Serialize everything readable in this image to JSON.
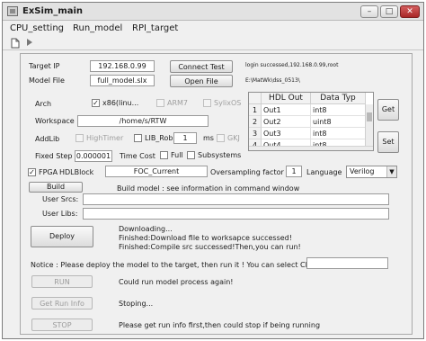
{
  "window": {
    "title": "ExSim_main",
    "controls": {
      "minimize": "–",
      "maximize": "□",
      "close": "✕"
    }
  },
  "menu": {
    "items": [
      "CPU_setting",
      "Run_model",
      "RPI_target"
    ]
  },
  "toolbar": {
    "icons": [
      "new-file-icon",
      "play-icon"
    ]
  },
  "target": {
    "ip_label": "Target IP",
    "ip_value": "192.168.0.99",
    "model_label": "Model File",
    "model_value": "full_model.slx",
    "connect_button": "Connect Test",
    "open_button": "Open File",
    "login_status": "login successed,192.168.0.99,root",
    "model_path": "E:\\MatWk\\dss_0513\\"
  },
  "arch": {
    "label": "Arch",
    "options": [
      {
        "label": "x86(linu...",
        "checked": true,
        "enabled": true
      },
      {
        "label": "ARM7",
        "checked": false,
        "enabled": false
      },
      {
        "label": "SylixOS",
        "checked": false,
        "enabled": false
      }
    ]
  },
  "workspace": {
    "label": "Workspace",
    "value": "/home/s/RTW"
  },
  "addlib": {
    "label": "AddLib",
    "hightimer": "HighTimer",
    "lib_robot": "LIB_Robot",
    "ms_value": "1",
    "ms_label": "ms",
    "gkj": "GKJ"
  },
  "fixed_step": {
    "label": "Fixed Step",
    "value": "0.000001",
    "time_cost": "Time Cost",
    "full": "Full",
    "subsystems": "Subsystems"
  },
  "fpga": {
    "label": "FPGA",
    "checked": true,
    "hdlblock_label": "HDLBlock",
    "hdlblock_value": "FOC_Current",
    "oversampling_label": "Oversampling factor",
    "oversampling_value": "1",
    "language_label": "Language",
    "language_value": "Verilog"
  },
  "hdl_table": {
    "headers": [
      "HDL Out",
      "Data Typ"
    ],
    "rows": [
      {
        "n": "1",
        "out": "Out1",
        "type": "int8"
      },
      {
        "n": "2",
        "out": "Out2",
        "type": "uint8"
      },
      {
        "n": "3",
        "out": "Out3",
        "type": "int8"
      },
      {
        "n": "4",
        "out": "Out4",
        "type": "int8"
      }
    ],
    "get_button": "Get",
    "set_button": "Set"
  },
  "build": {
    "button": "Build",
    "message": "Build model : see information in command window",
    "user_srcs_label": "User Srcs:",
    "user_libs_label": "User Libs:"
  },
  "deploy": {
    "button": "Deploy",
    "log": [
      "Downloading...",
      "Finished:Download file to worksapce successed!",
      "Finished:Compile src successed!Then,you can run!"
    ]
  },
  "notice": {
    "text": "Notice : Please deploy the model to the target, then run it ! You can select CPU:",
    "cpu_value": ""
  },
  "run": {
    "button": "RUN",
    "message": "Could run model process again!"
  },
  "runinfo": {
    "button": "Get Run Info",
    "message": "Stoping..."
  },
  "stop": {
    "button": "STOP",
    "message": "Please get run info first,then could stop if being running"
  }
}
